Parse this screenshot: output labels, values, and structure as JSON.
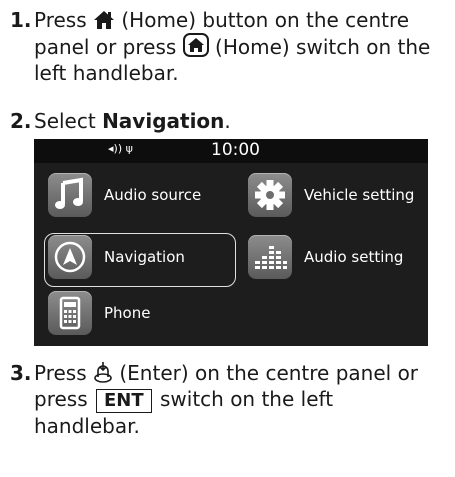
{
  "steps": [
    {
      "number": "1.",
      "text_a": "Press",
      "text_b": "(Home) button on the centre panel or press",
      "text_c": "(Home) switch on the left handlebar."
    },
    {
      "number": "2.",
      "text_a": "Select",
      "bold": "Navigation",
      "text_b": "."
    },
    {
      "number": "3.",
      "text_a": "Press",
      "text_b": "(Enter) on the centre panel or press",
      "key": "ENT",
      "text_c": "switch on the left handlebar."
    }
  ],
  "screen": {
    "clock": "10:00",
    "status_icons": "◂)) ψ",
    "menu": [
      {
        "label": "Audio source",
        "icon": "music-note-icon"
      },
      {
        "label": "Vehicle setting",
        "icon": "gear-icon"
      },
      {
        "label": "Navigation",
        "icon": "navigation-arrow-icon",
        "selected": true
      },
      {
        "label": "Audio setting",
        "icon": "equalizer-icon"
      },
      {
        "label": "Phone",
        "icon": "phone-icon"
      }
    ]
  }
}
